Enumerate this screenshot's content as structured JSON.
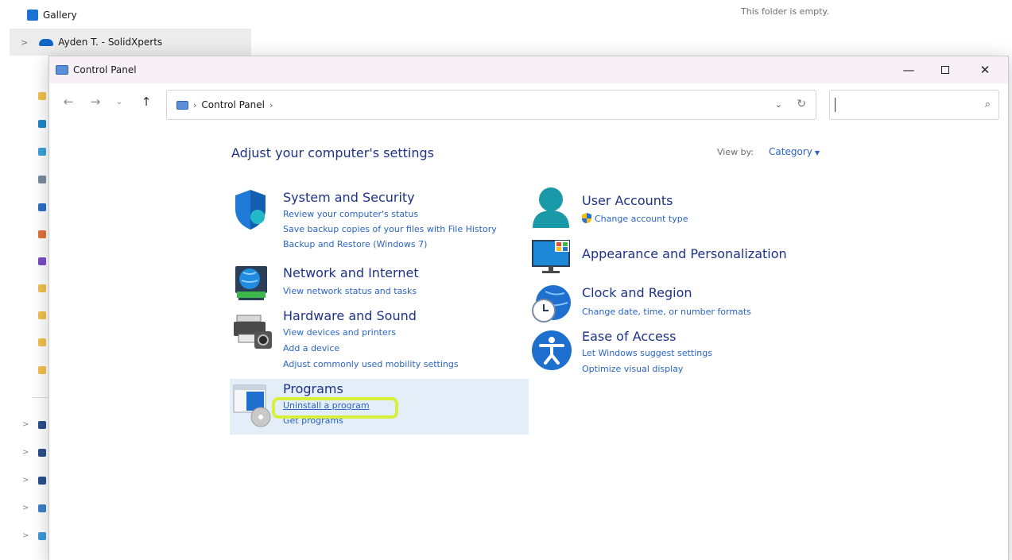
{
  "background": {
    "gallery_label": "Gallery",
    "onedrive_label": "Ayden T. - SolidXperts",
    "empty_message": "This folder is empty.",
    "chevron": ">"
  },
  "window": {
    "title": "Control Panel",
    "minimize": "—",
    "close": "✕"
  },
  "nav": {
    "back": "←",
    "forward": "→",
    "recent": "⌄",
    "up": "↑",
    "breadcrumb": "Control Panel",
    "separator": "›",
    "dropdown": "⌄",
    "refresh": "↻",
    "search_value": "",
    "search_icon": "⌕"
  },
  "content": {
    "heading": "Adjust your computer's settings",
    "view_by_label": "View by:",
    "view_by_value": "Category",
    "categories": {
      "system_security": {
        "title": "System and Security",
        "links": [
          "Review your computer's status",
          "Save backup copies of your files with File History",
          "Backup and Restore (Windows 7)"
        ]
      },
      "network_internet": {
        "title": "Network and Internet",
        "links": [
          "View network status and tasks"
        ]
      },
      "hardware_sound": {
        "title": "Hardware and Sound",
        "links": [
          "View devices and printers",
          "Add a device",
          "Adjust commonly used mobility settings"
        ]
      },
      "programs": {
        "title": "Programs",
        "links": [
          "Uninstall a program",
          "Get programs"
        ]
      },
      "user_accounts": {
        "title": "User Accounts",
        "links": [
          "Change account type"
        ]
      },
      "appearance": {
        "title": "Appearance and Personalization",
        "links": []
      },
      "clock_region": {
        "title": "Clock and Region",
        "links": [
          "Change date, time, or number formats"
        ]
      },
      "ease_access": {
        "title": "Ease of Access",
        "links": [
          "Let Windows suggest settings",
          "Optimize visual display"
        ]
      }
    }
  },
  "colors": {
    "heading": "#1e3287",
    "link": "#2b64c4",
    "highlight": "#e3eef9",
    "annotation_ring": "#d7f03c"
  }
}
